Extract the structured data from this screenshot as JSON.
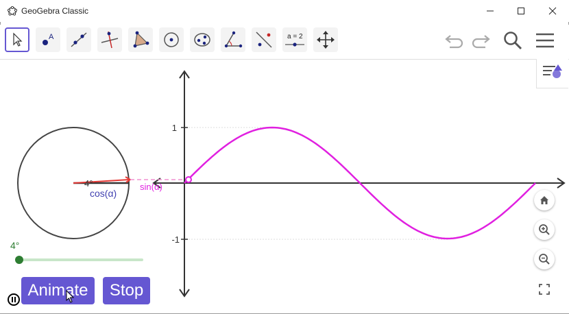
{
  "window": {
    "title": "GeoGebra Classic",
    "controls": [
      "minimize-icon",
      "maximize-icon",
      "close-icon"
    ]
  },
  "toolbar": {
    "tools": [
      {
        "name": "move-tool",
        "icon": "arrow-cursor-icon",
        "active": true
      },
      {
        "name": "point-tool",
        "icon": "point-icon"
      },
      {
        "name": "line-tool",
        "icon": "line-icon"
      },
      {
        "name": "perpendicular-line-tool",
        "icon": "perpendicular-icon"
      },
      {
        "name": "polygon-tool",
        "icon": "polygon-icon"
      },
      {
        "name": "circle-tool",
        "icon": "circle-center-icon"
      },
      {
        "name": "ellipse-tool",
        "icon": "ellipse-icon"
      },
      {
        "name": "angle-tool",
        "icon": "angle-icon"
      },
      {
        "name": "reflect-tool",
        "icon": "reflect-icon"
      },
      {
        "name": "slider-tool",
        "icon": "slider-icon",
        "label": "a = 2"
      },
      {
        "name": "move-graphics-tool",
        "icon": "move-arrows-icon"
      }
    ],
    "right": [
      "undo-icon",
      "redo-icon",
      "search-icon",
      "menu-icon"
    ]
  },
  "graphics": {
    "y_tick_1": "1",
    "y_tick_neg1": "-1",
    "angle_label": "4°",
    "cos_label": "cos(α)",
    "sin_label": "sin(α)",
    "slider_value": "4°",
    "slider_fraction": 0.011,
    "colors": {
      "curve": "#e020e0",
      "slider": "#2e7d32",
      "button": "#6557d2",
      "radius": "#e53935"
    }
  },
  "buttons": {
    "animate": "Animate",
    "stop": "Stop"
  },
  "view_controls": [
    "home-icon",
    "zoom-in-icon",
    "zoom-out-icon",
    "fullscreen-icon"
  ]
}
